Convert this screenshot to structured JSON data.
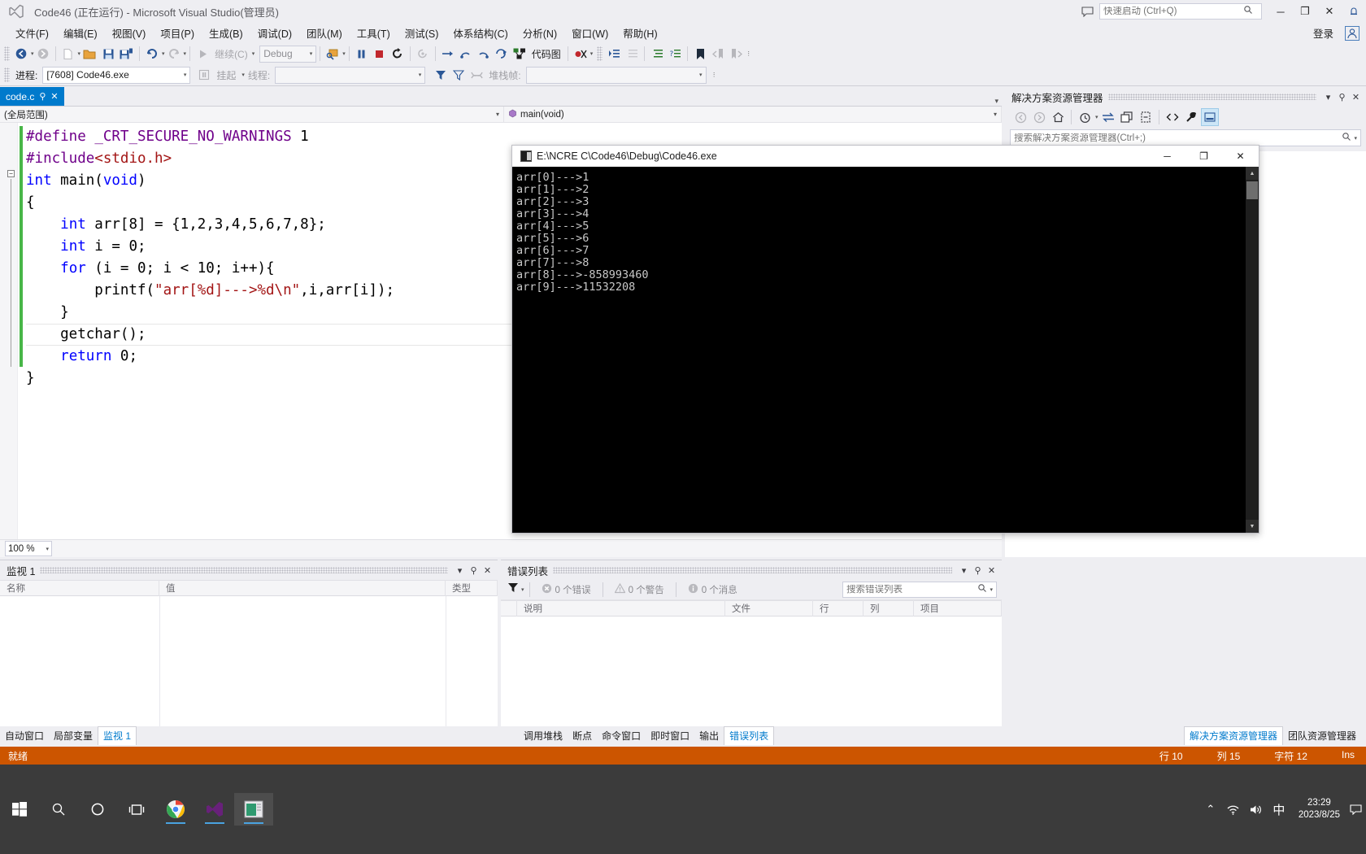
{
  "window": {
    "title": "Code46 (正在运行) - Microsoft Visual Studio(管理员)",
    "minimize": "─",
    "restore": "❐",
    "close": "✕",
    "feedback_icon": "comment-icon",
    "notify_icon": "bell-icon"
  },
  "quick_launch": {
    "placeholder": "快速启动 (Ctrl+Q)",
    "icon": "search-icon"
  },
  "menu": {
    "items": [
      {
        "label": "文件(F)"
      },
      {
        "label": "编辑(E)"
      },
      {
        "label": "视图(V)"
      },
      {
        "label": "项目(P)"
      },
      {
        "label": "生成(B)"
      },
      {
        "label": "调试(D)"
      },
      {
        "label": "团队(M)"
      },
      {
        "label": "工具(T)"
      },
      {
        "label": "测试(S)"
      },
      {
        "label": "体系结构(C)"
      },
      {
        "label": "分析(N)"
      },
      {
        "label": "窗口(W)"
      },
      {
        "label": "帮助(H)"
      }
    ],
    "signin": "登录"
  },
  "toolbar": {
    "nav_back": "◀",
    "nav_forward": "▶",
    "new_item": "new-file-icon",
    "open": "open-folder-icon",
    "save": "save-icon",
    "save_all": "save-all-icon",
    "undo": "undo-icon",
    "redo": "redo-icon",
    "continue_label": "继续(C)",
    "config": "Debug",
    "find_icon": "find-icon",
    "pause": "⏸",
    "stop": "■",
    "restart": "↻",
    "hot_reload": "hot-reload-icon",
    "step_into": "→",
    "step_over": "↷",
    "step_out": "↶",
    "step_back": "↻",
    "code_map_label": "代码图",
    "code_map_icon": "code-map-icon",
    "bookmark_icon": "bookmark-icon"
  },
  "debug_toolbar": {
    "process_label": "进程:",
    "process_value": "[7608] Code46.exe",
    "suspend_label": "挂起",
    "thread_label": "线程:",
    "thread_value": "",
    "stackframe_label": "堆栈帧:",
    "stackframe_value": ""
  },
  "editor": {
    "tab": {
      "name": "code.c",
      "pin": "⚲",
      "close": "✕"
    },
    "nav_scope": "(全局范围)",
    "nav_member": "main(void)",
    "nav_member_icon": "method-icon",
    "zoom": "100 %",
    "code_lines": [
      {
        "segments": [
          {
            "t": "#define",
            "c": "ppdir"
          },
          {
            "t": " ",
            "c": ""
          },
          {
            "t": "_CRT_SECURE_NO_WARNINGS",
            "c": "macro"
          },
          {
            "t": " 1",
            "c": ""
          }
        ]
      },
      {
        "segments": [
          {
            "t": "#include",
            "c": "ppdir"
          },
          {
            "t": "<stdio.h>",
            "c": "str"
          }
        ]
      },
      {
        "segments": [
          {
            "t": "int",
            "c": "kw"
          },
          {
            "t": " main(",
            "c": ""
          },
          {
            "t": "void",
            "c": "kw"
          },
          {
            "t": ")",
            "c": ""
          }
        ]
      },
      {
        "segments": [
          {
            "t": "{",
            "c": ""
          }
        ]
      },
      {
        "segments": [
          {
            "t": "    ",
            "c": ""
          },
          {
            "t": "int",
            "c": "kw"
          },
          {
            "t": " arr[8] = {1,2,3,4,5,6,7,8};",
            "c": ""
          }
        ]
      },
      {
        "segments": [
          {
            "t": "    ",
            "c": ""
          },
          {
            "t": "int",
            "c": "kw"
          },
          {
            "t": " i = 0;",
            "c": ""
          }
        ]
      },
      {
        "segments": [
          {
            "t": "    ",
            "c": ""
          },
          {
            "t": "for",
            "c": "kw"
          },
          {
            "t": " (i = 0; i < 10; i++){",
            "c": ""
          }
        ]
      },
      {
        "segments": [
          {
            "t": "        printf(",
            "c": ""
          },
          {
            "t": "\"arr[%d]--->%d\\n\"",
            "c": "str"
          },
          {
            "t": ",i,arr[i]);",
            "c": ""
          }
        ]
      },
      {
        "segments": [
          {
            "t": "    }",
            "c": ""
          }
        ]
      },
      {
        "segments": [
          {
            "t": "    getchar();",
            "c": ""
          }
        ]
      },
      {
        "segments": [
          {
            "t": "    ",
            "c": ""
          },
          {
            "t": "return",
            "c": "kw"
          },
          {
            "t": " 0;",
            "c": ""
          }
        ]
      },
      {
        "segments": [
          {
            "t": "}",
            "c": ""
          }
        ]
      }
    ]
  },
  "solution_explorer": {
    "title": "解决方案资源管理器",
    "search_placeholder": "搜索解决方案资源管理器(Ctrl+;)",
    "search_icon": "search-icon",
    "buttons": [
      {
        "name": "back",
        "glyph": "◀"
      },
      {
        "name": "forward",
        "glyph": "▶"
      },
      {
        "name": "home",
        "glyph": "⌂"
      },
      {
        "name": "pending-changes",
        "glyph": "◔"
      },
      {
        "name": "sync-with-active-document",
        "glyph": "⇄"
      },
      {
        "name": "refresh",
        "glyph": "❐"
      },
      {
        "name": "collapse-all",
        "glyph": "▤"
      },
      {
        "name": "show-all-files",
        "glyph": "<>"
      },
      {
        "name": "properties",
        "glyph": "🔧"
      },
      {
        "name": "preview-selected-items",
        "glyph": "▬"
      }
    ],
    "dropdown": "▾",
    "pin": "⚲",
    "close": "✕"
  },
  "console": {
    "title": "E:\\NCRE C\\Code46\\Debug\\Code46.exe",
    "minimize": "─",
    "maximize": "❐",
    "close": "✕",
    "output": "arr[0]--->1\narr[1]--->2\narr[2]--->3\narr[3]--->4\narr[4]--->5\narr[5]--->6\narr[6]--->7\narr[7]--->8\narr[8]--->-858993460\narr[9]--->11532208"
  },
  "watch_panel": {
    "title": "监视 1",
    "dropdown": "▾",
    "pin": "⚲",
    "close": "✕",
    "columns": [
      "名称",
      "值",
      "类型"
    ],
    "rows": []
  },
  "error_panel": {
    "title": "错误列表",
    "dropdown": "▾",
    "pin": "⚲",
    "close": "✕",
    "filter_icon": "filter-icon",
    "errors": "0 个错误",
    "warnings": "0 个警告",
    "messages": "0 个消息",
    "search_placeholder": "搜索错误列表",
    "search_icon": "search-icon",
    "columns": [
      "",
      "说明",
      "文件",
      "行",
      "列",
      "项目"
    ],
    "rows": []
  },
  "bottom_tabs_left": [
    {
      "label": "自动窗口",
      "active": false
    },
    {
      "label": "局部变量",
      "active": false
    },
    {
      "label": "监视 1",
      "active": true
    }
  ],
  "bottom_tabs_center": [
    {
      "label": "调用堆栈",
      "active": false
    },
    {
      "label": "断点",
      "active": false
    },
    {
      "label": "命令窗口",
      "active": false
    },
    {
      "label": "即时窗口",
      "active": false
    },
    {
      "label": "输出",
      "active": false
    },
    {
      "label": "错误列表",
      "active": true
    }
  ],
  "bottom_tabs_right": [
    {
      "label": "解决方案资源管理器",
      "active": true
    },
    {
      "label": "团队资源管理器",
      "active": false
    }
  ],
  "statusbar": {
    "state": "就绪",
    "line": "行 10",
    "col": "列 15",
    "char": "字符 12",
    "ins": "Ins",
    "accent": "#cc5500"
  },
  "taskbar": {
    "items": [
      {
        "name": "start-button",
        "glyph": "⊞"
      },
      {
        "name": "search-icon",
        "glyph": "🔍"
      },
      {
        "name": "cortana-icon",
        "glyph": "◯"
      },
      {
        "name": "task-view-icon",
        "glyph": "❑"
      },
      {
        "name": "chrome-icon",
        "glyph": ""
      },
      {
        "name": "visual-studio-icon",
        "glyph": ""
      },
      {
        "name": "console-window-icon",
        "glyph": ""
      }
    ],
    "tray": {
      "chevron": "⌃",
      "network_icon": "wifi-icon",
      "volume_icon": "speaker-icon",
      "ime": "中",
      "time": "23:29",
      "date": "2023/8/25",
      "notification_icon": "notification-icon"
    }
  }
}
